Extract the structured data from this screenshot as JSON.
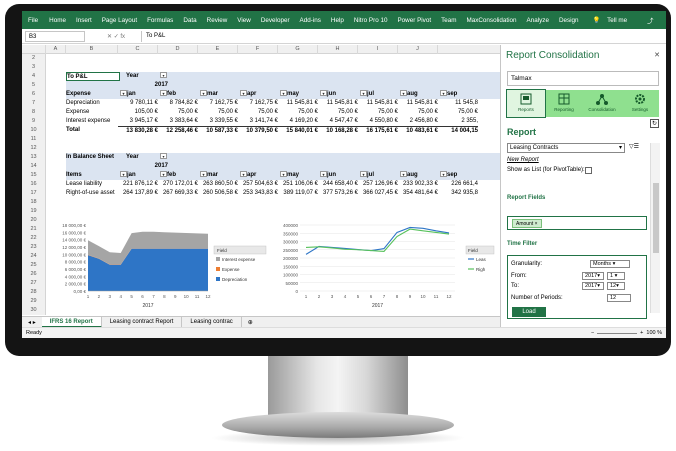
{
  "ribbon": {
    "tabs": [
      "File",
      "Home",
      "Insert",
      "Page Layout",
      "Formulas",
      "Data",
      "Review",
      "View",
      "Developer",
      "Add-ins",
      "Help",
      "Nitro Pro 10",
      "Power Pivot",
      "Team",
      "MaxConsolidation",
      "Analyze",
      "Design"
    ],
    "tell_me": "Tell me"
  },
  "formula": {
    "namebox": "B3",
    "fx": "fx",
    "value": "To P&L"
  },
  "columns": [
    "A",
    "B",
    "C",
    "D",
    "E",
    "F",
    "G",
    "H",
    "I",
    "J"
  ],
  "rows": [
    "2",
    "3",
    "4",
    "5",
    "6",
    "7",
    "8",
    "9",
    "10",
    "11",
    "12",
    "13",
    "14",
    "15",
    "16",
    "17",
    "18",
    "19",
    "20",
    "21",
    "22",
    "23",
    "24",
    "25",
    "26",
    "27",
    "28",
    "29",
    "30",
    "31"
  ],
  "pl": {
    "title": "To P&L",
    "year_label": "Year",
    "year": "2017",
    "header": "Expense",
    "months": [
      "jan",
      "feb",
      "mar",
      "apr",
      "may",
      "jun",
      "jul",
      "aug",
      "sep"
    ],
    "rows": [
      {
        "label": "Depreciation",
        "values": [
          "9 780,11 €",
          "8 784,82 €",
          "7 162,75 €",
          "7 162,75 €",
          "11 545,81 €",
          "11 545,81 €",
          "11 545,81 €",
          "11 545,81 €",
          "11 545,8"
        ]
      },
      {
        "label": "Expense",
        "values": [
          "105,00 €",
          "75,00 €",
          "75,00 €",
          "75,00 €",
          "75,00 €",
          "75,00 €",
          "75,00 €",
          "75,00 €",
          "75,00 €"
        ]
      },
      {
        "label": "Interest expense",
        "values": [
          "3 945,17 €",
          "3 383,64 €",
          "3 339,55 €",
          "3 141,74 €",
          "4 169,20 €",
          "4 547,47 €",
          "4 550,80 €",
          "2 456,80 €",
          "2 355,"
        ]
      },
      {
        "label": "Total",
        "values": [
          "13 830,28 €",
          "12 258,46 €",
          "10 587,33 €",
          "10 379,50 €",
          "15 840,01 €",
          "10 168,28 €",
          "16 175,61 €",
          "10 483,61 €",
          "14 004,15"
        ]
      }
    ]
  },
  "bs": {
    "title": "In Balance Sheet",
    "year_label": "Year",
    "year": "2017",
    "header": "Items",
    "months": [
      "jan",
      "feb",
      "mar",
      "apr",
      "may",
      "jun",
      "jul",
      "aug",
      "sep"
    ],
    "rows": [
      {
        "label": "Lease liability",
        "values": [
          "221 876,12 €",
          "270 172,01 €",
          "263 860,50 €",
          "257 504,63 €",
          "251 106,06 €",
          "244 658,40 €",
          "257 126,96 €",
          "233 902,33 €",
          "226 661,4"
        ]
      },
      {
        "label": "Right-of-use asset",
        "values": [
          "264 137,89 €",
          "267 669,33 €",
          "260 506,58 €",
          "253 343,83 €",
          "389 119,07 €",
          "377 573,26 €",
          "366 027,45 €",
          "354 481,64 €",
          "342 935,8"
        ]
      }
    ]
  },
  "chart_left": {
    "type": "area",
    "y_ticks": [
      "18 000,00 €",
      "16 000,00 €",
      "14 000,00 €",
      "12 000,00 €",
      "10 000,00 €",
      "8 000,00 €",
      "6 000,00 €",
      "4 000,00 €",
      "2 000,00 €",
      "0,00 €"
    ],
    "ylim": [
      0,
      18000
    ],
    "x": [
      "1",
      "2",
      "3",
      "4",
      "5",
      "6",
      "7",
      "8",
      "9",
      "10",
      "11",
      "12"
    ],
    "xlabel": "2017",
    "legend_title": "Field",
    "series": [
      {
        "name": "Depreciation",
        "color": "#2e75c6",
        "values": [
          9780,
          8785,
          7163,
          7163,
          11546,
          11546,
          11546,
          11546,
          11546,
          11546,
          11546,
          11546
        ]
      },
      {
        "name": "Expense",
        "color": "#ed7d31",
        "values": [
          105,
          75,
          75,
          75,
          75,
          75,
          75,
          75,
          75,
          75,
          75,
          75
        ]
      },
      {
        "name": "Interest expense",
        "color": "#a5a5a5",
        "values": [
          3945,
          3384,
          3340,
          3142,
          4169,
          4547,
          4551,
          4400,
          4300,
          4200,
          4100,
          4000
        ]
      }
    ]
  },
  "chart_right": {
    "type": "line",
    "y_ticks": [
      "400000",
      "350000",
      "300000",
      "250000",
      "200000",
      "150000",
      "100000",
      "50000",
      "0"
    ],
    "ylim": [
      0,
      400000
    ],
    "x": [
      "1",
      "2",
      "3",
      "4",
      "5",
      "6",
      "7",
      "8",
      "9",
      "10",
      "11",
      "12"
    ],
    "xlabel": "2017",
    "legend_title": "Field",
    "series": [
      {
        "name": "Leas",
        "color": "#2e75c6",
        "values": [
          222000,
          270000,
          264000,
          258000,
          251000,
          245000,
          257000,
          355000,
          385000,
          380000,
          365000,
          352000
        ]
      },
      {
        "name": "Righ",
        "color": "#57c15b",
        "values": [
          264000,
          268000,
          261000,
          253000,
          250000,
          245000,
          240000,
          330000,
          375000,
          365000,
          355000,
          345000
        ]
      }
    ]
  },
  "sheets": [
    "IFRS 16 Report",
    "Leasing contract Report",
    "Leasing contrac"
  ],
  "status": {
    "ready": "Ready",
    "zoom": "100 %"
  },
  "pane": {
    "title": "Report Consolidation",
    "company": "Talmax",
    "nav": [
      {
        "label": "Reports"
      },
      {
        "label": "Reporting"
      },
      {
        "label": "Consolidation"
      },
      {
        "label": "Settings"
      }
    ],
    "report_heading": "Report",
    "report_select": "Leasing Contracts",
    "new_report": "New Report",
    "show_list": "Show as List (for PivotTable):",
    "fields_heading": "Report Fields",
    "field_chip": "Amount ×",
    "time_heading": "Time Filter",
    "granularity_label": "Granularity:",
    "granularity": "Months",
    "from_label": "From:",
    "from_year": "2017",
    "from_month": "1",
    "to_label": "To:",
    "to_year": "2017",
    "to_month": "12",
    "periods_label": "Number of Periods:",
    "periods": "12",
    "load": "Load"
  },
  "colors": {
    "excel_green": "#217346",
    "band": "#dbe4f1"
  }
}
